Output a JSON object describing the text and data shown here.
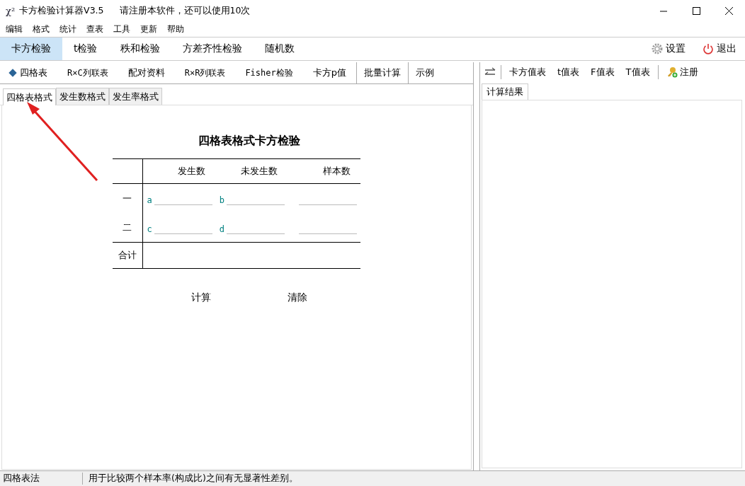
{
  "window": {
    "icon_text": "χ²",
    "title": "卡方检验计算器V3.5",
    "notice": "请注册本软件，还可以使用10次"
  },
  "menu": [
    "编辑",
    "格式",
    "统计",
    "查表",
    "工具",
    "更新",
    "帮助"
  ],
  "main_tabs": [
    {
      "label": "卡方检验",
      "selected": true
    },
    {
      "label": "t检验",
      "selected": false
    },
    {
      "label": "秩和检验",
      "selected": false
    },
    {
      "label": "方差齐性检验",
      "selected": false
    },
    {
      "label": "随机数",
      "selected": false
    }
  ],
  "actions": [
    {
      "kind": "settings",
      "label": "设置"
    },
    {
      "kind": "exit",
      "label": "退出"
    }
  ],
  "sub_tabs": [
    {
      "label": "四格表",
      "selected": true
    },
    {
      "label": "R×C列联表",
      "selected": false
    },
    {
      "label": "配对资料",
      "selected": false
    },
    {
      "label": "R×R列联表",
      "selected": false
    },
    {
      "label": "Fisher检验",
      "selected": false
    },
    {
      "label": "卡方p值",
      "selected": false
    }
  ],
  "sub_buttons": [
    "批量计算",
    "示例"
  ],
  "right_toolbar": [
    {
      "kind": "swap"
    },
    {
      "kind": "text",
      "label": "卡方值表"
    },
    {
      "kind": "text",
      "label": "t值表"
    },
    {
      "kind": "text",
      "label": "F值表"
    },
    {
      "kind": "text",
      "label": "T值表"
    },
    {
      "kind": "key",
      "label": "注册"
    }
  ],
  "format_tabs": [
    {
      "label": "四格表格式",
      "selected": true
    },
    {
      "label": "发生数格式",
      "selected": false
    },
    {
      "label": "发生率格式",
      "selected": false
    }
  ],
  "form": {
    "title": "四格表格式卡方检验",
    "headers": [
      "发生数",
      "未发生数",
      "样本数"
    ],
    "rows": [
      {
        "label": "一",
        "cells": [
          {
            "letter": "a"
          },
          {
            "letter": "b"
          },
          {}
        ]
      },
      {
        "label": "二",
        "cells": [
          {
            "letter": "c"
          },
          {
            "letter": "d"
          },
          {}
        ]
      }
    ],
    "total_label": "合计",
    "buttons": [
      "计算",
      "清除"
    ]
  },
  "result_tabs": [
    {
      "label": "计算结果",
      "selected": true
    }
  ],
  "status_bar": [
    "四格表法",
    "用于比较两个样本率(构成比)之间有无显著性差别。"
  ]
}
